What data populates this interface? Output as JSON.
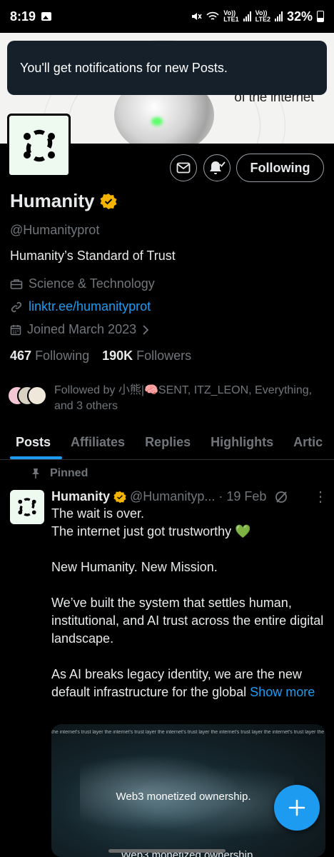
{
  "status_bar": {
    "time": "8:19",
    "net1": "Vo))\nLTE1",
    "net2": "Vo))\nLTE2",
    "battery": "32%"
  },
  "banner": {
    "text": "of the internet"
  },
  "toast": {
    "message": "You'll get notifications for new Posts."
  },
  "profile": {
    "name": "Humanity",
    "handle": "@Humanityprot",
    "bio": "Humanity’s Standard of Trust",
    "category": "Science & Technology",
    "link": "linktr.ee/humanityprot",
    "joined": "Joined March 2023",
    "following_count": "467",
    "following_label": "Following",
    "followers_count": "190K",
    "followers_label": "Followers",
    "followed_by": "Followed by 小熊|🧠SENT, ITZ_LEON, Everything, and 3 others",
    "follow_button": "Following"
  },
  "tabs": [
    {
      "label": "Posts",
      "active": true
    },
    {
      "label": "Affiliates"
    },
    {
      "label": "Replies"
    },
    {
      "label": "Highlights"
    },
    {
      "label": "Artic"
    }
  ],
  "post": {
    "pinned_label": "Pinned",
    "author": "Humanity",
    "handle": "@Humanityp...",
    "sep": "·",
    "date": "19 Feb",
    "more": "⋮",
    "line1": "The wait is over.",
    "line2": "The internet just got trustworthy 💚",
    "line3": "New Humanity. New Mission.",
    "line4": "We’ve built the system that settles human, institutional, and AI trust across the entire digital landscape.",
    "line5": "As AI breaks legacy identity, we are the new default infrastructure for the global",
    "show_more": "Show more",
    "media_caption": "Web3 monetized ownership.",
    "media_caption2": "Web3 monetized ownership.",
    "media_strip": "the internet's trust layer   the internet's trust layer   the internet's trust layer   the internet's trust layer   the internet's trust layer   the internet's trust layer"
  },
  "colors": {
    "accent": "#1d9bf0",
    "verified": "#f5b400",
    "muted": "#71767b",
    "toast_bg": "#15202b"
  },
  "icons": {
    "mail": "mail-icon",
    "bell": "bell-check-icon",
    "category": "briefcase-icon",
    "link": "link-icon",
    "calendar": "calendar-icon",
    "pin": "pin-icon",
    "grok": "grok-icon",
    "compose": "plus-icon"
  }
}
